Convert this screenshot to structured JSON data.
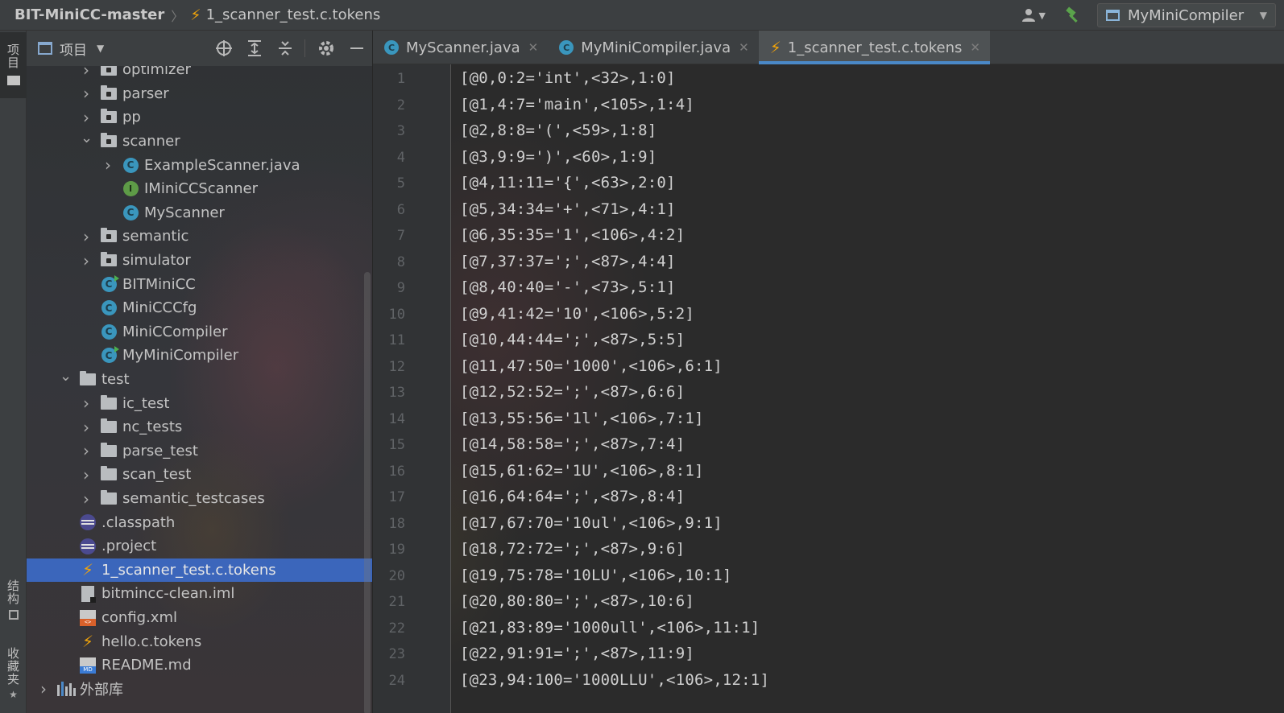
{
  "topbar": {
    "project_name": "BIT-MiniCC-master",
    "file_name": "1_scanner_test.c.tokens",
    "run_config": "MyMiniCompiler"
  },
  "leftstrip": {
    "project_tab": "项目",
    "structure_tab": "结构",
    "favorites_tab": "收藏夹"
  },
  "panel": {
    "title": "项目",
    "items": [
      {
        "label": "optimizer",
        "icon": "folder-package-icon",
        "depth": 2,
        "arrow": "collapsed"
      },
      {
        "label": "parser",
        "icon": "folder-package-icon",
        "depth": 2,
        "arrow": "collapsed"
      },
      {
        "label": "pp",
        "icon": "folder-package-icon",
        "depth": 2,
        "arrow": "collapsed"
      },
      {
        "label": "scanner",
        "icon": "folder-package-icon",
        "depth": 2,
        "arrow": "expanded"
      },
      {
        "label": "ExampleScanner.java",
        "icon": "java-class-icon",
        "depth": 3,
        "arrow": "collapsed"
      },
      {
        "label": "IMiniCCScanner",
        "icon": "interface-icon",
        "depth": 3,
        "arrow": "none"
      },
      {
        "label": "MyScanner",
        "icon": "java-class-icon",
        "depth": 3,
        "arrow": "none"
      },
      {
        "label": "semantic",
        "icon": "folder-package-icon",
        "depth": 2,
        "arrow": "collapsed"
      },
      {
        "label": "simulator",
        "icon": "folder-package-icon",
        "depth": 2,
        "arrow": "collapsed"
      },
      {
        "label": "BITMiniCC",
        "icon": "runnable-class-icon",
        "depth": 2,
        "arrow": "none"
      },
      {
        "label": "MiniCCCfg",
        "icon": "java-class-icon",
        "depth": 2,
        "arrow": "none"
      },
      {
        "label": "MiniCCompiler",
        "icon": "java-class-icon",
        "depth": 2,
        "arrow": "none"
      },
      {
        "label": "MyMiniCompiler",
        "icon": "runnable-class-icon",
        "depth": 2,
        "arrow": "none"
      },
      {
        "label": "test",
        "icon": "folder-icon",
        "depth": 1,
        "arrow": "expanded"
      },
      {
        "label": "ic_test",
        "icon": "folder-icon",
        "depth": 2,
        "arrow": "collapsed"
      },
      {
        "label": "nc_tests",
        "icon": "folder-icon",
        "depth": 2,
        "arrow": "collapsed"
      },
      {
        "label": "parse_test",
        "icon": "folder-icon",
        "depth": 2,
        "arrow": "collapsed"
      },
      {
        "label": "scan_test",
        "icon": "folder-icon",
        "depth": 2,
        "arrow": "collapsed"
      },
      {
        "label": "semantic_testcases",
        "icon": "folder-icon",
        "depth": 2,
        "arrow": "collapsed"
      },
      {
        "label": ".classpath",
        "icon": "eclipse-icon",
        "depth": 1,
        "arrow": "none"
      },
      {
        "label": ".project",
        "icon": "eclipse-icon",
        "depth": 1,
        "arrow": "none"
      },
      {
        "label": "1_scanner_test.c.tokens",
        "icon": "bolt-icon",
        "depth": 1,
        "arrow": "none",
        "selected": true
      },
      {
        "label": "bitmincc-clean.iml",
        "icon": "iml-file-icon",
        "depth": 1,
        "arrow": "none"
      },
      {
        "label": "config.xml",
        "icon": "xml-file-icon",
        "depth": 1,
        "arrow": "none"
      },
      {
        "label": "hello.c.tokens",
        "icon": "bolt-icon",
        "depth": 1,
        "arrow": "none"
      },
      {
        "label": "README.md",
        "icon": "markdown-file-icon",
        "depth": 1,
        "arrow": "none"
      },
      {
        "label": "外部库",
        "icon": "library-icon",
        "depth": 0,
        "arrow": "collapsed"
      }
    ]
  },
  "tabs": [
    {
      "label": "MyScanner.java",
      "icon": "java-class-icon",
      "active": false
    },
    {
      "label": "MyMiniCompiler.java",
      "icon": "java-class-icon",
      "active": false
    },
    {
      "label": "1_scanner_test.c.tokens",
      "icon": "bolt-icon",
      "active": true
    }
  ],
  "editor": {
    "lines": [
      "[@0,0:2='int',<32>,1:0]",
      "[@1,4:7='main',<105>,1:4]",
      "[@2,8:8='(',<59>,1:8]",
      "[@3,9:9=')',<60>,1:9]",
      "[@4,11:11='{',<63>,2:0]",
      "[@5,34:34='+',<71>,4:1]",
      "[@6,35:35='1',<106>,4:2]",
      "[@7,37:37=';',<87>,4:4]",
      "[@8,40:40='-',<73>,5:1]",
      "[@9,41:42='10',<106>,5:2]",
      "[@10,44:44=';',<87>,5:5]",
      "[@11,47:50='1000',<106>,6:1]",
      "[@12,52:52=';',<87>,6:6]",
      "[@13,55:56='1l',<106>,7:1]",
      "[@14,58:58=';',<87>,7:4]",
      "[@15,61:62='1U',<106>,8:1]",
      "[@16,64:64=';',<87>,8:4]",
      "[@17,67:70='10ul',<106>,9:1]",
      "[@18,72:72=';',<87>,9:6]",
      "[@19,75:78='10LU',<106>,10:1]",
      "[@20,80:80=';',<87>,10:6]",
      "[@21,83:89='1000ull',<106>,11:1]",
      "[@22,91:91=';',<87>,11:9]",
      "[@23,94:100='1000LLU',<106>,12:1]"
    ]
  }
}
